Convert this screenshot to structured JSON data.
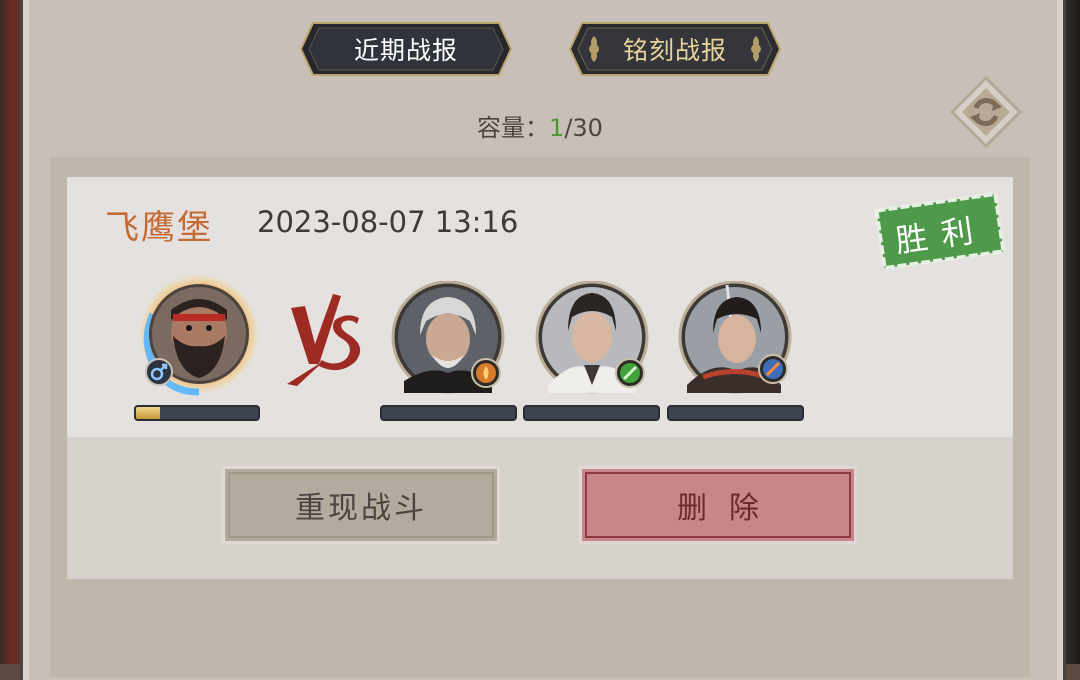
{
  "tabs": {
    "recent_label": "近期战报",
    "engraved_label": "铭刻战报"
  },
  "capacity": {
    "label": "容量：",
    "current": "1",
    "separator_total": "/30"
  },
  "report": {
    "location": "飞鹰堡",
    "datetime": "2023-08-07 13:16",
    "result": "胜利",
    "player": {
      "portrait": "bearded-warrior-portrait",
      "badge": "male-icon",
      "hp_fraction": 0.2
    },
    "enemies": [
      {
        "portrait": "white-haired-elder-portrait",
        "badge": "fire-element-icon",
        "hp_fraction": 0
      },
      {
        "portrait": "young-swordsman-portrait",
        "badge": "wind-element-icon",
        "hp_fraction": 0
      },
      {
        "portrait": "dark-haired-swordsman-portrait",
        "badge": "blade-element-icon",
        "hp_fraction": 0
      }
    ]
  },
  "actions": {
    "replay_label": "重现战斗",
    "delete_label": "删除"
  },
  "colors": {
    "location": "#c66a34",
    "capacity_current": "#4c9a2e",
    "victory_stamp": "#4f9a4a",
    "delete_button": "#c9868a"
  }
}
